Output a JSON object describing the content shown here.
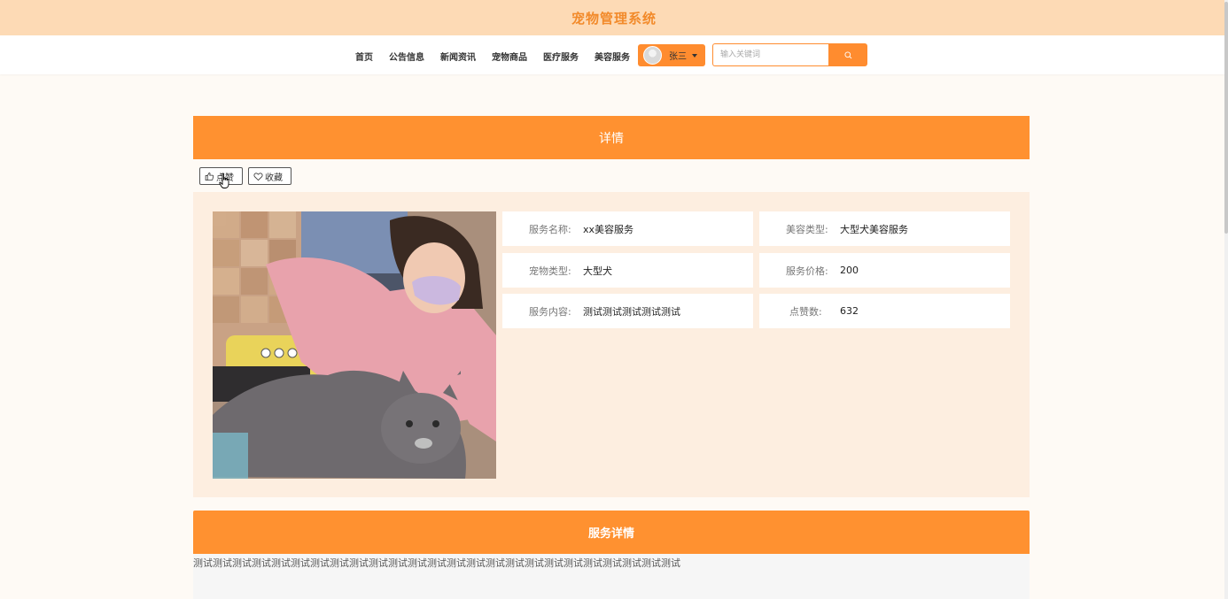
{
  "app": {
    "title": "宠物管理系统"
  },
  "nav": {
    "items": [
      {
        "label": "首页"
      },
      {
        "label": "公告信息"
      },
      {
        "label": "新闻资讯"
      },
      {
        "label": "宠物商品"
      },
      {
        "label": "医疗服务"
      },
      {
        "label": "美容服务"
      }
    ]
  },
  "user": {
    "name": "张三"
  },
  "search": {
    "placeholder": "输入关键词"
  },
  "detail": {
    "header": "详情",
    "like_label": "点赞",
    "favorite_label": "收藏",
    "fields": [
      {
        "label": "服务名称:",
        "value": "xx美容服务"
      },
      {
        "label": "美容类型:",
        "value": "大型犬美容服务"
      },
      {
        "label": "宠物类型:",
        "value": "大型犬"
      },
      {
        "label": "服务价格:",
        "value": "200"
      },
      {
        "label": "服务内容:",
        "value": "测试测试测试测试测试"
      },
      {
        "label": "点赞数:",
        "value": "632"
      }
    ]
  },
  "service_detail": {
    "header": "服务详情",
    "text": "测试测试测试测试测试测试测试测试测试测试测试测试测试测试测试测试测试测试测试测试测试测试测试测试测试"
  },
  "colors": {
    "accent": "#ff9130",
    "banner": "#fddab5",
    "title": "#f28a2a",
    "panel": "#fdeee0"
  }
}
